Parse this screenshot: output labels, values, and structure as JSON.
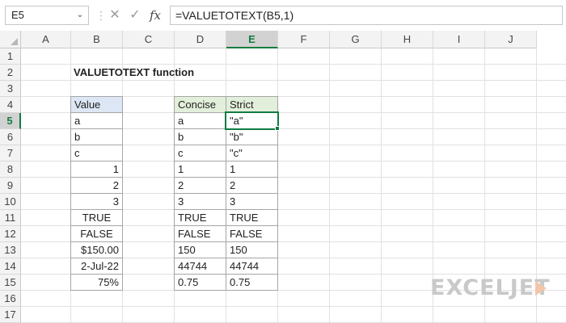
{
  "formula_bar": {
    "name_box": "E5",
    "name_box_arrow": "⌄",
    "separator": "⋮",
    "cancel_icon": "✕",
    "confirm_icon": "✓",
    "fx_label": "fx",
    "formula": "=VALUETOTEXT(B5,1)"
  },
  "columns": [
    "A",
    "B",
    "C",
    "D",
    "E",
    "F",
    "G",
    "H",
    "I",
    "J"
  ],
  "rows": [
    "1",
    "2",
    "3",
    "4",
    "5",
    "6",
    "7",
    "8",
    "9",
    "10",
    "11",
    "12",
    "13",
    "14",
    "15",
    "16",
    "17"
  ],
  "selected": {
    "column": "E",
    "row": "5"
  },
  "sheet": {
    "title": "VALUETOTEXT function",
    "value_table": {
      "header": "Value",
      "items": [
        "a",
        "b",
        "c",
        "1",
        "2",
        "3",
        "TRUE",
        "FALSE",
        "$150.00",
        "2-Jul-22",
        "75%"
      ]
    },
    "results_table": {
      "headers": [
        "Concise",
        "Strict"
      ],
      "rows": [
        [
          "a",
          "\"a\""
        ],
        [
          "b",
          "\"b\""
        ],
        [
          "c",
          "\"c\""
        ],
        [
          "1",
          "1"
        ],
        [
          "2",
          "2"
        ],
        [
          "3",
          "3"
        ],
        [
          "TRUE",
          "TRUE"
        ],
        [
          "FALSE",
          "FALSE"
        ],
        [
          "150",
          "150"
        ],
        [
          "44744",
          "44744"
        ],
        [
          "0.75",
          "0.75"
        ]
      ]
    }
  },
  "logo": {
    "text": "EXCELJET",
    "icon": "exceljet-logo-icon"
  },
  "colors": {
    "accent": "#107c41",
    "value_header": "#dce6f4",
    "results_header": "#e2efda"
  }
}
